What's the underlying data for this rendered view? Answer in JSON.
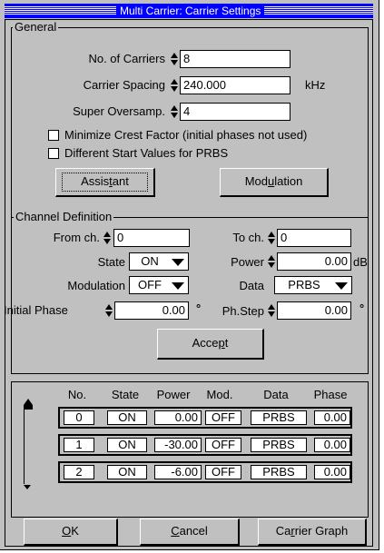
{
  "window": {
    "title": "Multi Carrier: Carrier Settings"
  },
  "general": {
    "label": "General",
    "no_of_carriers": {
      "label": "No. of Carriers",
      "value": "8"
    },
    "carrier_spacing": {
      "label": "Carrier Spacing",
      "value": "240.000",
      "unit": "kHz"
    },
    "super_oversamp": {
      "label": "Super Oversamp.",
      "value": "4"
    },
    "minimize_crest": {
      "label": "Minimize Crest Factor (initial phases not used)",
      "checked": false
    },
    "different_start": {
      "label": "Different Start Values for PRBS",
      "checked": false
    },
    "assistant_button": {
      "pre": "Assis",
      "u": "t",
      "post": "ant"
    },
    "modulation_button": {
      "pre": "Mod",
      "u": "u",
      "post": "lation"
    }
  },
  "channel": {
    "label": "Channel Definition",
    "from_ch": {
      "label": "From ch.",
      "value": "0"
    },
    "to_ch": {
      "label": "To ch.",
      "value": "0"
    },
    "state": {
      "label": "State",
      "value": "ON"
    },
    "power": {
      "label": "Power",
      "value": "0.00",
      "unit": "dB"
    },
    "modulation": {
      "label": "Modulation",
      "value": "OFF"
    },
    "data": {
      "label": "Data",
      "value": "PRBS"
    },
    "initial_phase": {
      "label": "Initial Phase",
      "value": "0.00",
      "unit": "°"
    },
    "ph_step": {
      "label": "Ph.Step",
      "value": "0.00",
      "unit": "°"
    },
    "accept_button": {
      "pre": "Acce",
      "u": "p",
      "post": "t"
    }
  },
  "table": {
    "headers": [
      "No.",
      "State",
      "Power",
      "Mod.",
      "Data",
      "Phase"
    ],
    "rows": [
      {
        "no": "0",
        "state": "ON",
        "power": "0.00",
        "mod": "OFF",
        "data": "PRBS",
        "phase": "0.00"
      },
      {
        "no": "1",
        "state": "ON",
        "power": "-30.00",
        "mod": "OFF",
        "data": "PRBS",
        "phase": "0.00"
      },
      {
        "no": "2",
        "state": "ON",
        "power": "-6.00",
        "mod": "OFF",
        "data": "PRBS",
        "phase": "0.00"
      }
    ]
  },
  "footer": {
    "ok_button": {
      "pre": "",
      "u": "O",
      "post": "K"
    },
    "cancel_button": {
      "pre": "",
      "u": "C",
      "post": "ancel"
    },
    "graph_button": {
      "pre": "Ca",
      "u": "r",
      "post": "rier Graph"
    }
  },
  "icons": {
    "spin": "spin-up-down-icon",
    "dropdown": "dropdown-arrow-icon",
    "scroll_up": "arrow-up-icon",
    "scroll_down": "arrow-down-icon"
  }
}
